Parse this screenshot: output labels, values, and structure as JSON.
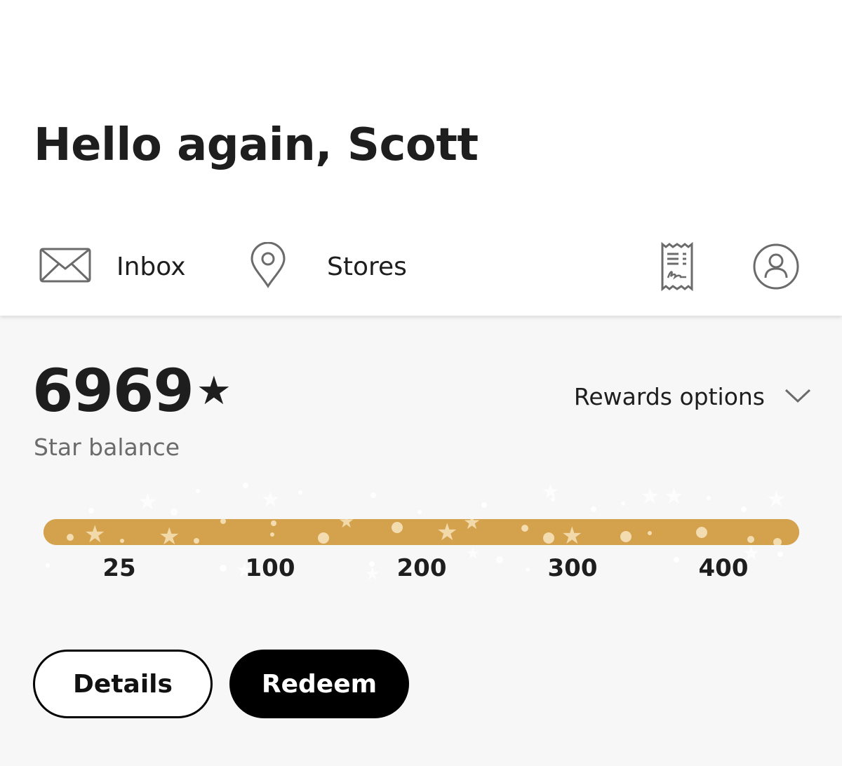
{
  "header": {
    "greeting": "Hello again, Scott",
    "nav": {
      "inbox": {
        "label": "Inbox",
        "icon": "envelope-icon"
      },
      "stores": {
        "label": "Stores",
        "icon": "location-pin-icon"
      }
    },
    "actions": {
      "receipt_icon": "receipt-icon",
      "account_icon": "account-icon"
    }
  },
  "rewards": {
    "balance": "6969",
    "star_glyph": "★",
    "caption": "Star balance",
    "options_label": "Rewards options",
    "options_icon": "chevron-down-icon",
    "progress": {
      "ticks": [
        "25",
        "100",
        "200",
        "300",
        "400"
      ],
      "fill_fraction": 1.0,
      "color": "#d4a24c"
    }
  },
  "buttons": {
    "details": "Details",
    "redeem": "Redeem"
  }
}
